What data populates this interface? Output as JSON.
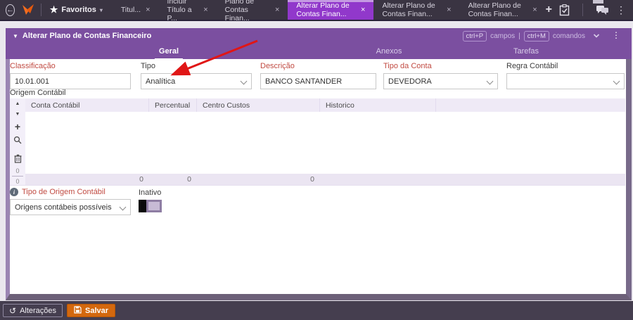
{
  "icons": {
    "back": "←",
    "star": "★",
    "caret_down": "▾",
    "close": "×",
    "plus": "+",
    "kebab": "⋮",
    "panel_collapse": "▼",
    "sort_up": "▲",
    "sort_down": "▼",
    "grid_plus": "+",
    "undo": "↺",
    "info": "i"
  },
  "colors": {
    "topbar_bg": "#3a3442",
    "active_tab_purple": "#9138cb",
    "panel_purple": "#7b4fa0",
    "label_red": "#c14b42",
    "salvar_orange": "#d4680e",
    "arrow_red": "#e01616",
    "logo_orange": "#f26d21"
  },
  "topbar": {
    "favorites_label": "Favoritos",
    "tabs": [
      {
        "label": "Titul...",
        "active": false
      },
      {
        "label": "Incluir Título a P...",
        "active": false
      },
      {
        "label": "Plano de Contas Finan...",
        "active": false
      },
      {
        "label": "Alterar Plano de Contas Finan...",
        "active": true
      },
      {
        "label": "Alterar Plano de Contas Finan...",
        "active": false
      },
      {
        "label": "Alterar Plano de Contas Finan...",
        "active": false
      }
    ]
  },
  "panel": {
    "title": "Alterar Plano de Contas Financeiro",
    "shortcuts": {
      "fields_key": "ctrl+P",
      "fields_label": "campos",
      "separator": "|",
      "commands_key": "ctrl+M",
      "commands_label": "comandos"
    },
    "tabs": [
      {
        "label": "Geral",
        "active": true
      },
      {
        "label": "Anexos",
        "active": false
      },
      {
        "label": "Tarefas",
        "active": false
      }
    ]
  },
  "form": {
    "classificacao": {
      "label": "Classificação",
      "value": "10.01.001"
    },
    "tipo": {
      "label": "Tipo",
      "value": "Analítica"
    },
    "descricao": {
      "label": "Descrição",
      "value": "BANCO SANTANDER"
    },
    "tipo_da_conta": {
      "label": "Tipo da Conta",
      "value": "DEVEDORA"
    },
    "regra_contabil": {
      "label": "Regra Contábil",
      "value": ""
    }
  },
  "grid": {
    "section_label": "Origem Contábil",
    "columns": [
      "Conta Contábil",
      "Percentual",
      "Centro Custos",
      "Historico"
    ],
    "totals": [
      "0",
      "0",
      "0"
    ],
    "counter_top": "0",
    "counter_bottom": "0"
  },
  "origem": {
    "label": "Tipo de Origem Contábil",
    "value": "Origens contábeis possíveis",
    "inativo_label": "Inativo"
  },
  "footer": {
    "alteracoes_label": "Alterações",
    "salvar_label": "Salvar"
  }
}
